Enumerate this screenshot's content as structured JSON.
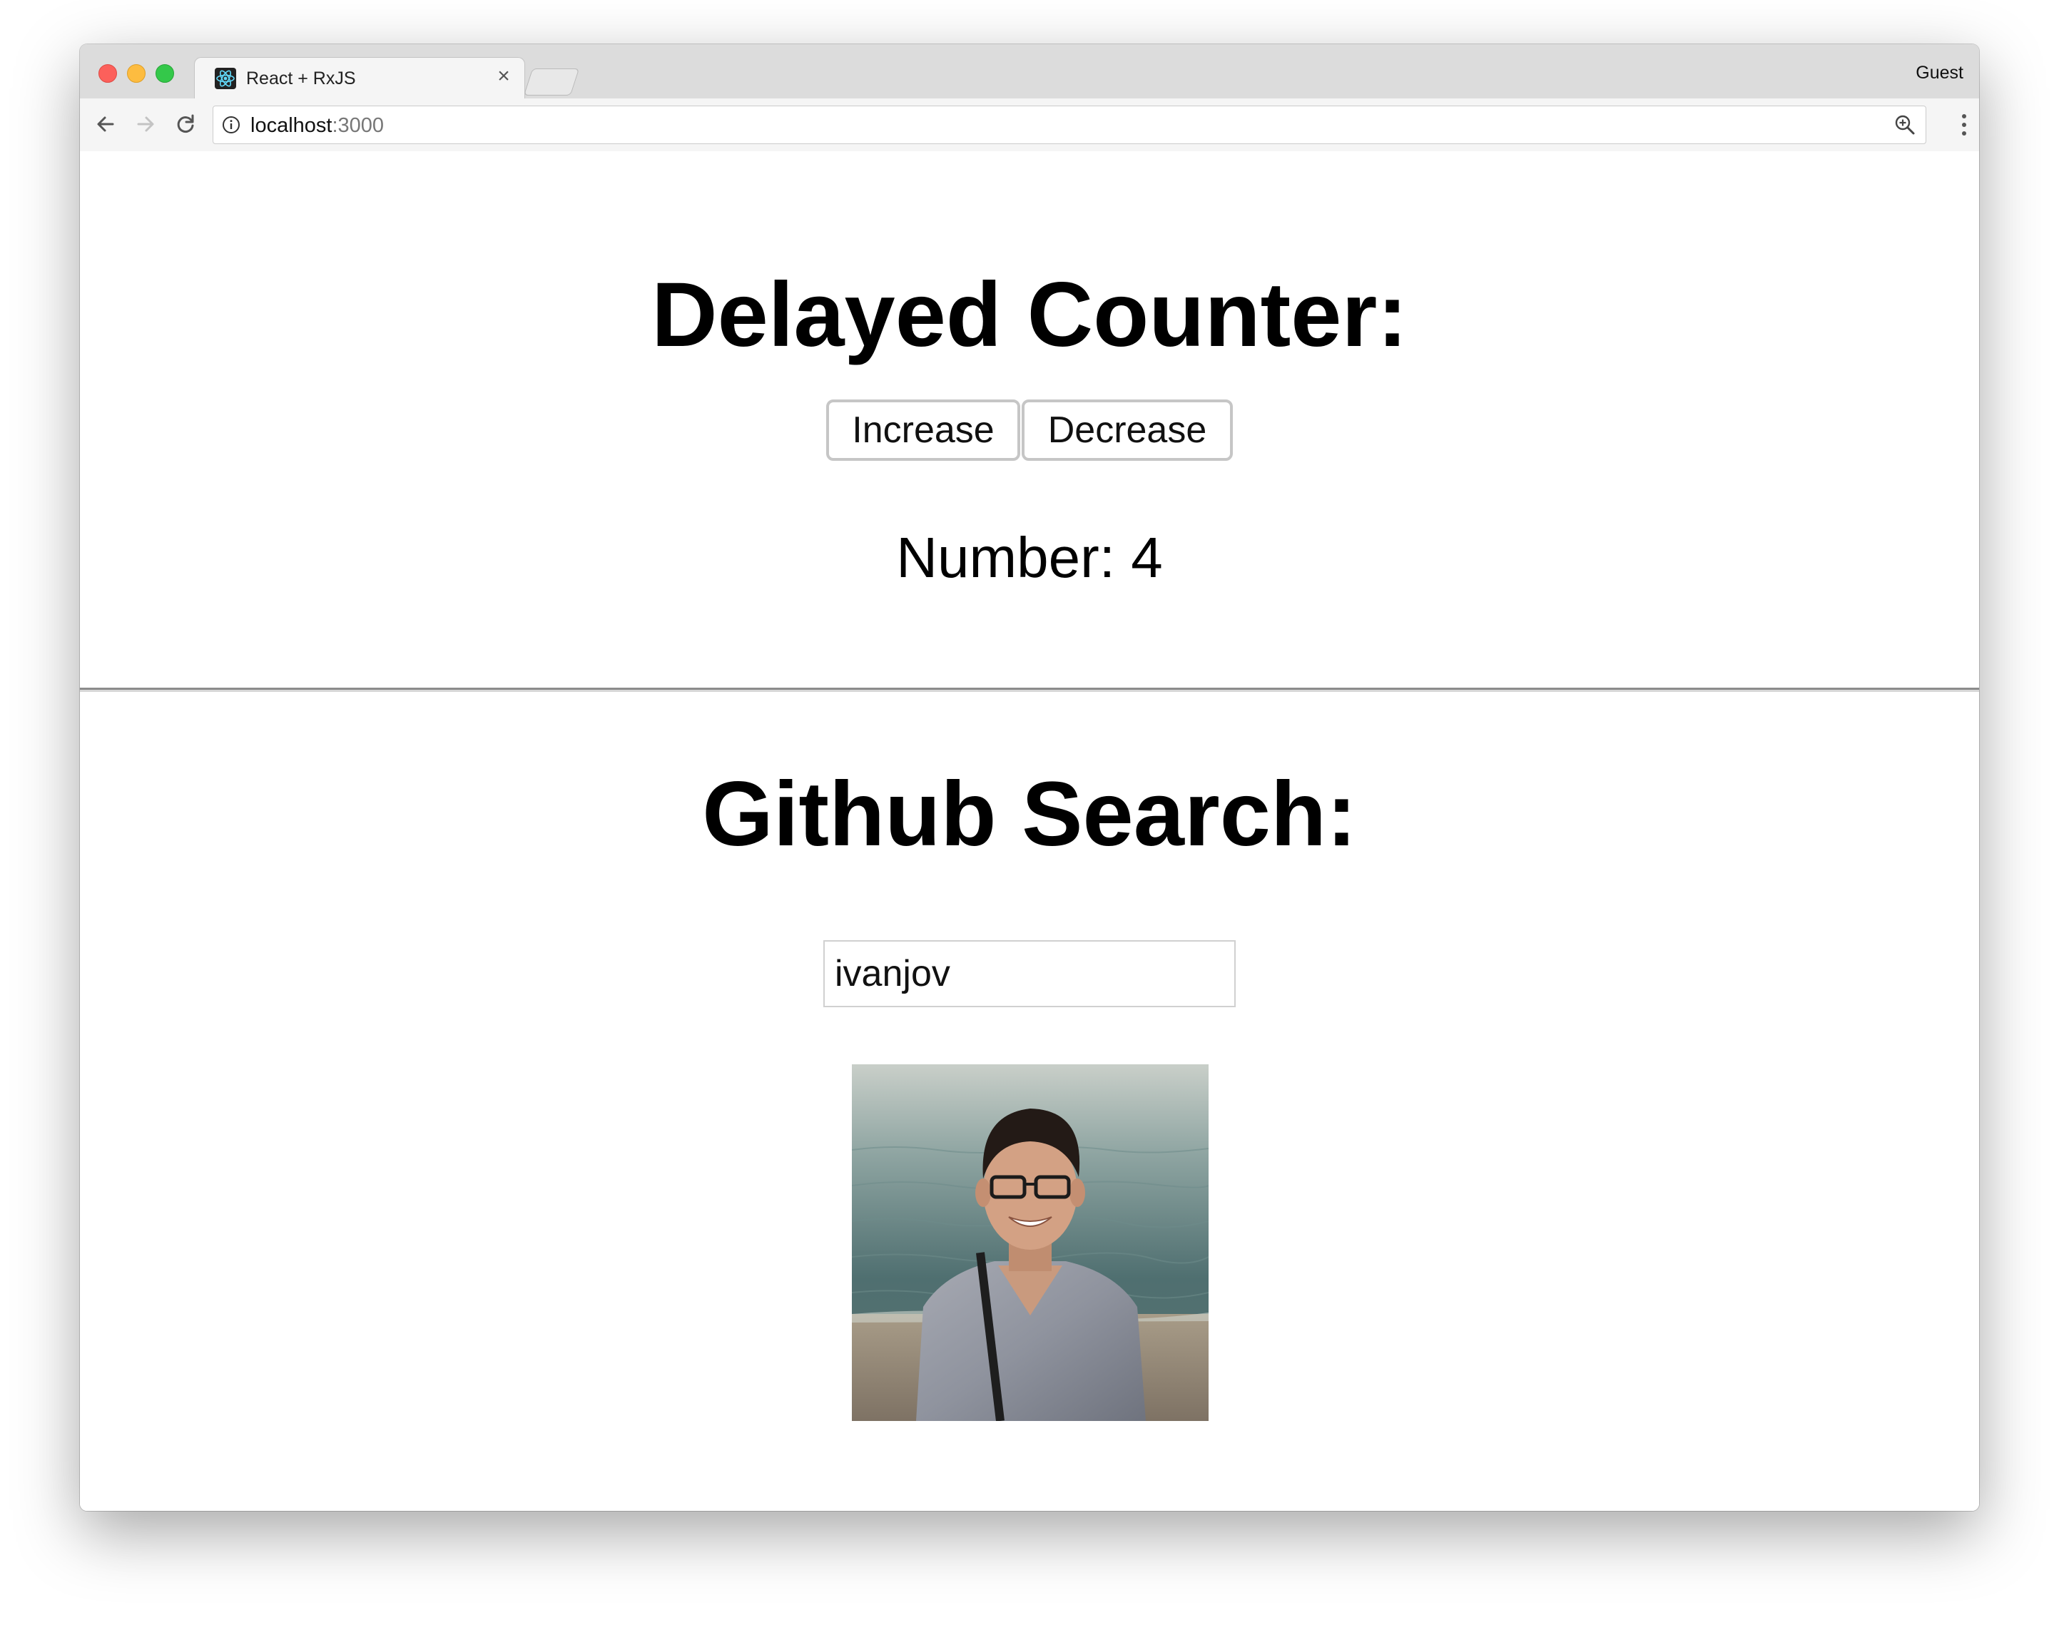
{
  "browser": {
    "tab_title": "React + RxJS",
    "tab_close": "×",
    "profile": "Guest",
    "url_host": "localhost",
    "url_port": ":3000"
  },
  "counter": {
    "title": "Delayed Counter:",
    "increase_label": "Increase",
    "decrease_label": "Decrease",
    "number_label": "Number:",
    "number_value": "4"
  },
  "search": {
    "title": "Github Search:",
    "query": "ivanjov"
  },
  "icons": {
    "back": "arrow-left-icon",
    "forward": "arrow-right-icon",
    "reload": "reload-icon",
    "info": "info-icon",
    "zoom": "zoom-icon",
    "menu": "vertical-dots-icon",
    "favicon": "react-logo-icon"
  }
}
